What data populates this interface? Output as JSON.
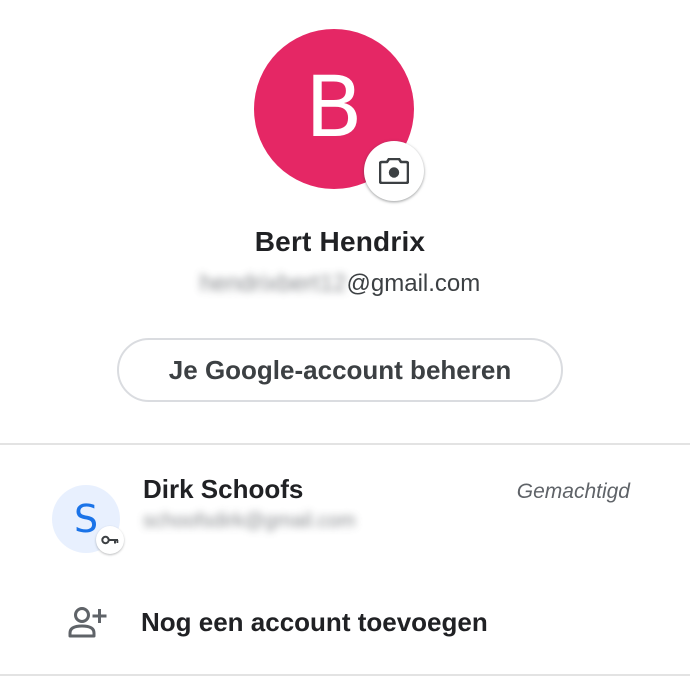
{
  "primary_account": {
    "initial": "B",
    "avatar_color": "#e52765",
    "name": "Bert Hendrix",
    "email_local_blurred": "hendrixbert12",
    "email_domain": "@gmail.com",
    "change_photo_icon": "camera-icon"
  },
  "manage_account_button": {
    "label": "Je Google-account beheren"
  },
  "secondary_account": {
    "initial": "S",
    "avatar_bg": "#e8f0fe",
    "initial_color": "#1a73e8",
    "badge_icon": "key-icon",
    "name": "Dirk Schoofs",
    "email_blurred": "schoofsdirk@gmail.com",
    "status": "Gemachtigd"
  },
  "add_account": {
    "icon": "person-add-icon",
    "label": "Nog een account toevoegen"
  }
}
